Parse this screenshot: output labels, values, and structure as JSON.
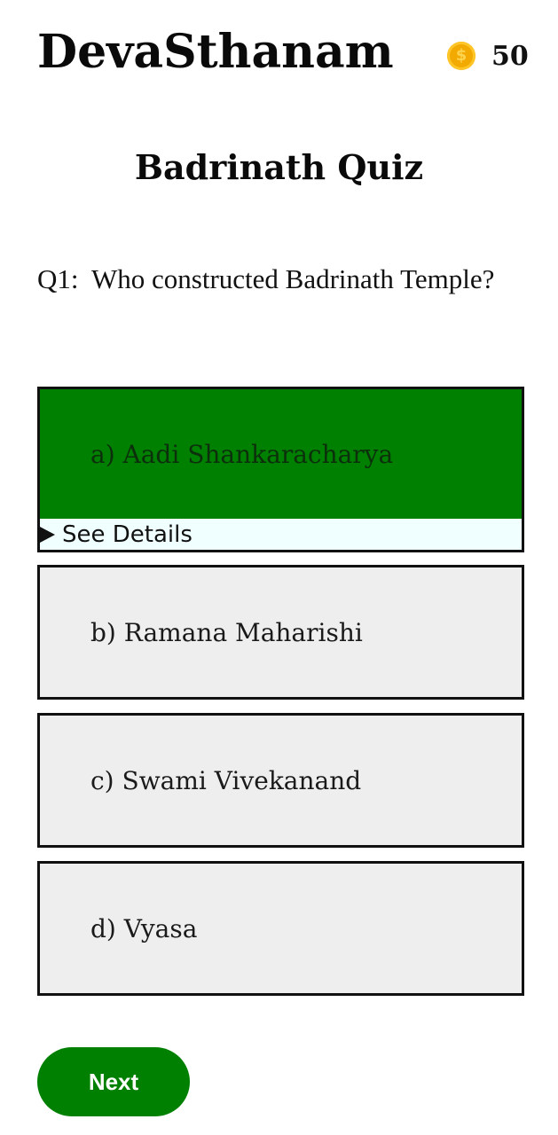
{
  "header": {
    "app_title": "DevaSthanam",
    "coin_icon": "coin-icon",
    "coin_symbol": "$",
    "coin_count": "50"
  },
  "quiz": {
    "title": "Badrinath Quiz",
    "question_number": "Q1:",
    "question_text": "Who constructed Badrinath Temple?",
    "options": [
      {
        "label": "a) Aadi Shankaracharya",
        "state": "correct"
      },
      {
        "label": "b) Ramana Maharishi",
        "state": "default"
      },
      {
        "label": "c) Swami Vivekanand",
        "state": "default"
      },
      {
        "label": "d) Vyasa",
        "state": "default"
      }
    ],
    "details_label": "See Details",
    "next_label": "Next"
  },
  "colors": {
    "correct": "#008000",
    "option_bg": "#eeeeee",
    "details_bg": "#f0ffff",
    "coin": "#f2a900",
    "next_button": "#008000"
  }
}
